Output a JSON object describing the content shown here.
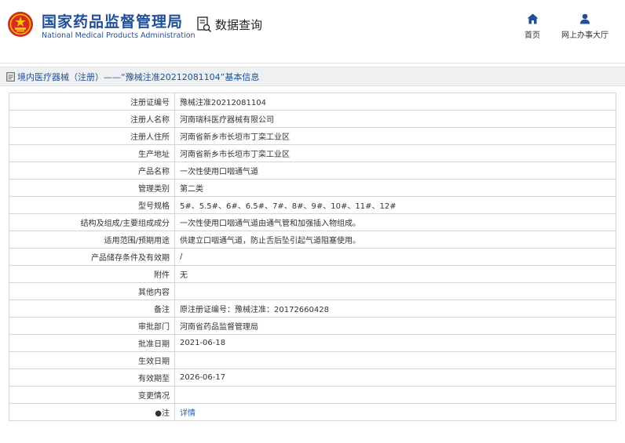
{
  "header": {
    "agency_cn": "国家药品监督管理局",
    "agency_en": "National Medical Products Administration",
    "query_label": "数据查询",
    "nav": {
      "home": "首页",
      "online_office": "网上办事大厅"
    }
  },
  "breadcrumb": {
    "title": "境内医疗器械（注册）——“豫械注准20212081104”基本信息"
  },
  "details": [
    {
      "label": "注册证编号",
      "value": "豫械注准20212081104"
    },
    {
      "label": "注册人名称",
      "value": "河南瑞科医疗器械有限公司"
    },
    {
      "label": "注册人住所",
      "value": "河南省新乡市长垣市丁栾工业区"
    },
    {
      "label": "生产地址",
      "value": "河南省新乡市长垣市丁栾工业区"
    },
    {
      "label": "产品名称",
      "value": "一次性使用口咽通气道"
    },
    {
      "label": "管理类别",
      "value": "第二类"
    },
    {
      "label": "型号规格",
      "value": "5#、5.5#、6#、6.5#、7#、8#、9#、10#、11#、12#"
    },
    {
      "label": "结构及组成/主要组成成分",
      "value": "一次性使用口咽通气道由通气管和加强插入物组成。"
    },
    {
      "label": "适用范围/预期用途",
      "value": "供建立口咽通气道，防止舌后坠引起气道阻塞使用。"
    },
    {
      "label": "产品储存条件及有效期",
      "value": "/"
    },
    {
      "label": "附件",
      "value": "无"
    },
    {
      "label": "其他内容",
      "value": ""
    },
    {
      "label": "备注",
      "value": "原注册证编号：豫械注准：20172660428"
    },
    {
      "label": "审批部门",
      "value": "河南省药品监督管理局"
    },
    {
      "label": "批准日期",
      "value": "2021-06-18"
    },
    {
      "label": "生效日期",
      "value": ""
    },
    {
      "label": "有效期至",
      "value": "2026-06-17"
    },
    {
      "label": "变更情况",
      "value": ""
    },
    {
      "label": "●注",
      "value": "详情"
    }
  ],
  "colors": {
    "brand_blue": "#1f4f98",
    "emblem_red": "#d52b1e",
    "emblem_gold": "#f5c400",
    "link_blue": "#1f5fbf"
  }
}
